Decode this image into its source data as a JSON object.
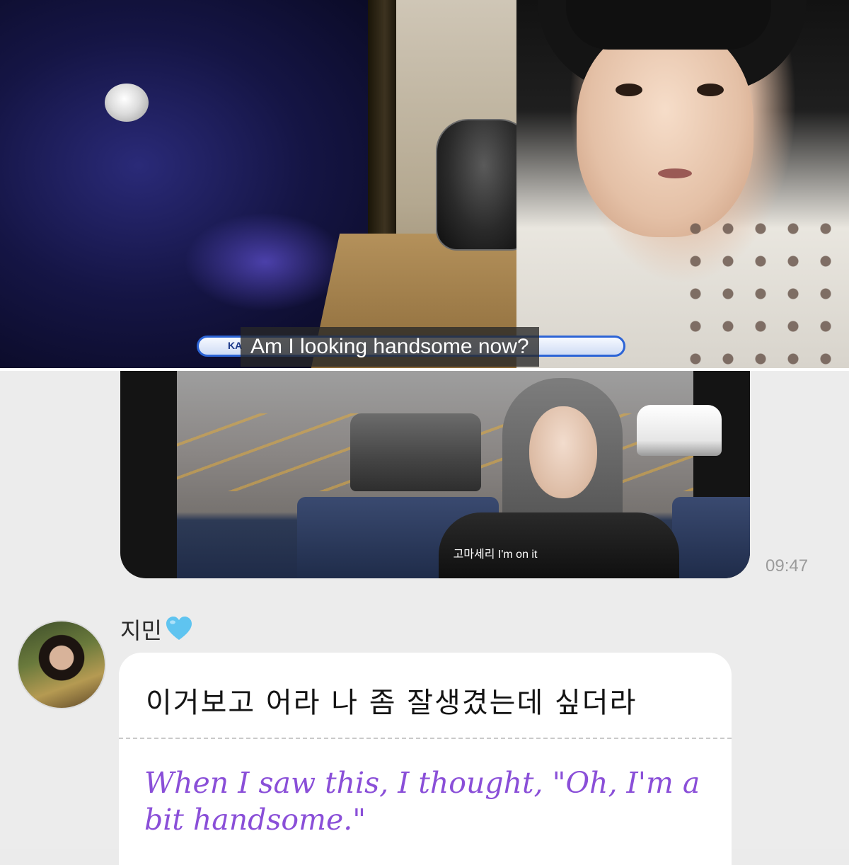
{
  "top_frame": {
    "banner_logo": "KA",
    "caption": "Am I looking handsome now?"
  },
  "chat": {
    "video_message": {
      "subtitle": "고마세리 I'm on it",
      "timestamp": "09:47"
    },
    "sender": {
      "name": "지민",
      "heart_color": "#5fc4f0"
    },
    "message": {
      "korean": "이거보고 어라 나 좀 잘생겼는데 싶더라",
      "english": "When I saw this, I thought, \"Oh, I'm a bit handsome.\""
    },
    "colors": {
      "background": "#ececec",
      "translation": "#8a4fd8"
    }
  }
}
